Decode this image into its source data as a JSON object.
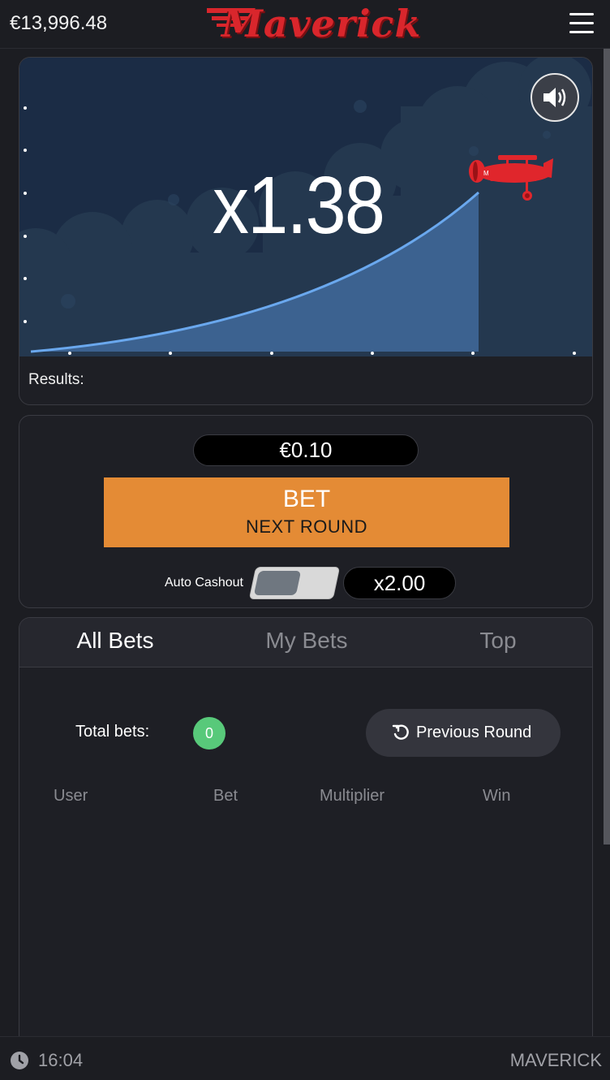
{
  "header": {
    "balance": "€13,996.48",
    "logo_text": "Maverick",
    "menu_icon": "hamburger-menu-icon"
  },
  "game": {
    "multiplier": "x1.38",
    "results_label": "Results:",
    "sound_icon": "speaker-icon",
    "plane_icon": "biplane-icon",
    "colors": {
      "sky": "#1b2c45",
      "curve": "#4a8fd8",
      "plane": "#e0262c"
    }
  },
  "bet": {
    "amount": "€0.10",
    "button_line1": "BET",
    "button_line2": "NEXT ROUND",
    "auto_cashout_label": "Auto Cashout",
    "auto_cashout_enabled": false,
    "auto_cashout_value": "x2.00",
    "colors": {
      "button": "#e48b35"
    }
  },
  "bets": {
    "tabs": [
      {
        "label": "All Bets",
        "active": true
      },
      {
        "label": "My Bets",
        "active": false
      },
      {
        "label": "Top",
        "active": false
      }
    ],
    "total_label": "Total bets:",
    "total_count": "0",
    "previous_round_label": "Previous Round",
    "columns": [
      "User",
      "Bet",
      "Multiplier",
      "Win"
    ],
    "colors": {
      "badge": "#58c97a"
    }
  },
  "footer": {
    "time": "16:04",
    "brand": "MAVERICK"
  }
}
